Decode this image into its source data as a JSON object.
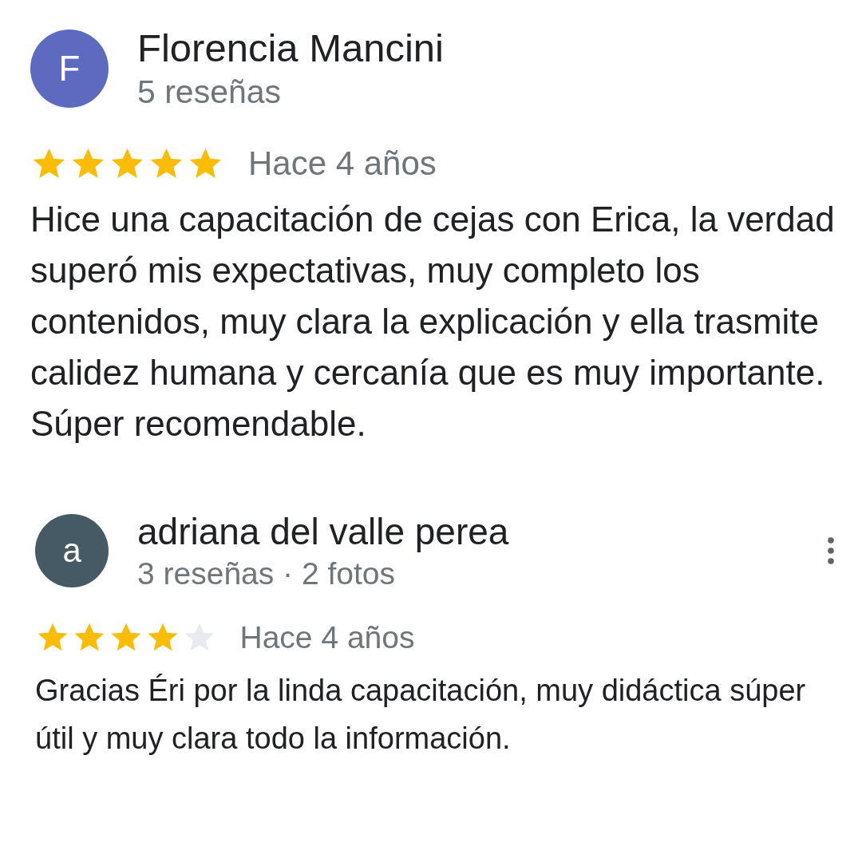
{
  "reviews": [
    {
      "initial": "F",
      "color": "#5c6bc0",
      "name": "Florencia Mancini",
      "meta": "5 reseñas",
      "stars": 5,
      "time": "Hace 4 años",
      "menu": false,
      "text": "Hice una capacitación de cejas con Erica, la verdad superó mis expectativas, muy completo los contenidos, muy clara la explicación y ella trasmite calidez humana y cercanía que es muy importante. Súper recomendable."
    },
    {
      "initial": "a",
      "color": "#455a64",
      "name": "adriana del valle perea",
      "meta": "3 reseñas · 2 fotos",
      "stars": 4,
      "time": "Hace 4 años",
      "menu": true,
      "text": "Gracias Éri por la linda capacitación, muy didáctica súper útil y muy clara todo la información."
    }
  ]
}
